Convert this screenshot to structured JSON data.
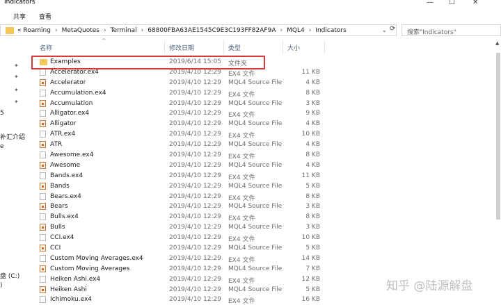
{
  "window": {
    "title": "Indicators",
    "min_glyph": "—",
    "max_glyph": "☐",
    "close_glyph": "✕"
  },
  "menu": {
    "share": "共享",
    "view": "查看"
  },
  "address": {
    "lead": "«",
    "crumbs": [
      "Roaming",
      "MetaQuotes",
      "Terminal",
      "68800FBA63AE1545C9E3C193FF82AF9A",
      "MQL4",
      "Indicators"
    ],
    "separator": "›",
    "dropdown": "⌄",
    "refresh": "⟳"
  },
  "search": {
    "placeholder": "搜索\"Indicators\""
  },
  "left_pane": {
    "texts": [
      "5",
      "补汇介绍",
      "e",
      "盘 (C:)",
      ")"
    ]
  },
  "columns": {
    "name": "名称",
    "date": "修改日期",
    "type": "类型",
    "size": "大小",
    "sort_glyph": "^"
  },
  "files": [
    {
      "name": "Examples",
      "date": "2019/6/14 15:05",
      "type": "文件夹",
      "size": "",
      "icon": "folder-icon"
    },
    {
      "name": "Accelerator.ex4",
      "date": "2019/4/10 12:29",
      "type": "EX4 文件",
      "size": "11 KB",
      "icon": "ex4-file-icon"
    },
    {
      "name": "Accelerator",
      "date": "2019/4/10 12:29",
      "type": "MQL4 Source File",
      "size": "4 KB",
      "icon": "mql4-source-icon"
    },
    {
      "name": "Accumulation.ex4",
      "date": "2019/4/10 12:29",
      "type": "EX4 文件",
      "size": "8 KB",
      "icon": "ex4-file-icon"
    },
    {
      "name": "Accumulation",
      "date": "2019/4/10 12:29",
      "type": "MQL4 Source File",
      "size": "3 KB",
      "icon": "mql4-source-icon"
    },
    {
      "name": "Alligator.ex4",
      "date": "2019/4/10 12:29",
      "type": "EX4 文件",
      "size": "9 KB",
      "icon": "ex4-file-icon"
    },
    {
      "name": "Alligator",
      "date": "2019/4/10 12:29",
      "type": "MQL4 Source File",
      "size": "4 KB",
      "icon": "mql4-source-icon"
    },
    {
      "name": "ATR.ex4",
      "date": "2019/4/10 12:29",
      "type": "EX4 文件",
      "size": "10 KB",
      "icon": "ex4-file-icon"
    },
    {
      "name": "ATR",
      "date": "2019/4/10 12:29",
      "type": "MQL4 Source File",
      "size": "4 KB",
      "icon": "mql4-source-icon"
    },
    {
      "name": "Awesome.ex4",
      "date": "2019/4/10 12:29",
      "type": "EX4 文件",
      "size": "8 KB",
      "icon": "ex4-file-icon"
    },
    {
      "name": "Awesome",
      "date": "2019/4/10 12:29",
      "type": "MQL4 Source File",
      "size": "4 KB",
      "icon": "mql4-source-icon"
    },
    {
      "name": "Bands.ex4",
      "date": "2019/4/10 12:29",
      "type": "EX4 文件",
      "size": "11 KB",
      "icon": "ex4-file-icon"
    },
    {
      "name": "Bands",
      "date": "2019/4/10 12:29",
      "type": "MQL4 Source File",
      "size": "5 KB",
      "icon": "mql4-source-icon"
    },
    {
      "name": "Bears.ex4",
      "date": "2019/4/10 12:29",
      "type": "EX4 文件",
      "size": "8 KB",
      "icon": "ex4-file-icon"
    },
    {
      "name": "Bears",
      "date": "2019/4/10 12:29",
      "type": "MQL4 Source File",
      "size": "3 KB",
      "icon": "mql4-source-icon"
    },
    {
      "name": "Bulls.ex4",
      "date": "2019/4/10 12:29",
      "type": "EX4 文件",
      "size": "8 KB",
      "icon": "ex4-file-icon"
    },
    {
      "name": "Bulls",
      "date": "2019/4/10 12:29",
      "type": "MQL4 Source File",
      "size": "3 KB",
      "icon": "mql4-source-icon"
    },
    {
      "name": "CCI.ex4",
      "date": "2019/4/10 12:29",
      "type": "EX4 文件",
      "size": "10 KB",
      "icon": "ex4-file-icon"
    },
    {
      "name": "CCI",
      "date": "2019/4/10 12:29",
      "type": "MQL4 Source File",
      "size": "5 KB",
      "icon": "mql4-source-icon"
    },
    {
      "name": "Custom Moving Averages.ex4",
      "date": "2019/4/10 12:29",
      "type": "EX4 文件",
      "size": "14 KB",
      "icon": "ex4-file-icon"
    },
    {
      "name": "Custom Moving Averages",
      "date": "2019/4/10 12:29",
      "type": "MQL4 Source File",
      "size": "7 KB",
      "icon": "mql4-source-icon"
    },
    {
      "name": "Heiken Ashi.ex4",
      "date": "2019/4/10 12:29",
      "type": "EX4 文件",
      "size": "12 KB",
      "icon": "ex4-file-icon"
    },
    {
      "name": "Heiken Ashi",
      "date": "2019/4/10 12:29",
      "type": "MQL4 Source File",
      "size": "5 KB",
      "icon": "mql4-source-icon"
    },
    {
      "name": "Ichimoku.ex4",
      "date": "2019/4/10 12:29",
      "type": "EX4 文件",
      "size": "16 KB",
      "icon": "ex4-file-icon"
    }
  ],
  "watermark": "知乎 @陆源解盘",
  "colors": {
    "highlight_border": "#d63a3a",
    "folder": "#f3c75a",
    "header_text": "#4c607a"
  }
}
